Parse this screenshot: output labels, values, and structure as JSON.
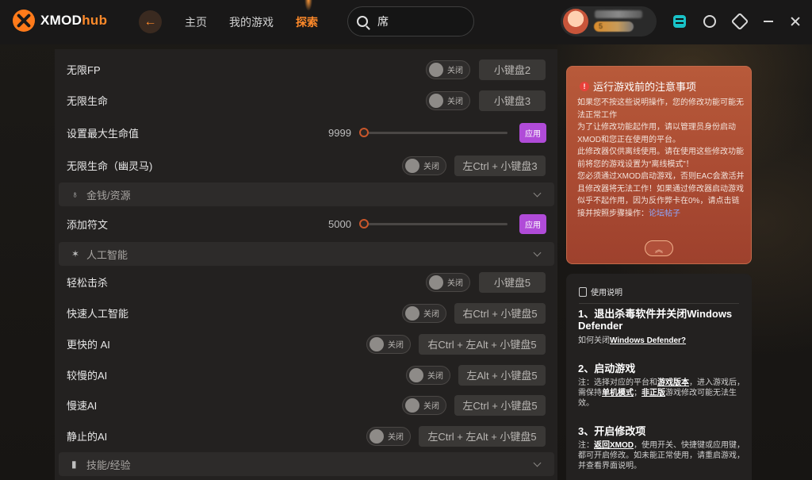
{
  "app": {
    "logo_main": "XMOD",
    "logo_accent": "hub"
  },
  "nav": {
    "back": "←",
    "home": "主页",
    "my_games": "我的游戏",
    "explore": "探索"
  },
  "search": {
    "value": "席"
  },
  "user": {
    "badge": "5"
  },
  "rows": {
    "inf_fp": {
      "label": "无限FP",
      "toggle": "关闭",
      "hotkey": "小键盘2"
    },
    "inf_hp": {
      "label": "无限生命",
      "toggle": "关闭",
      "hotkey": "小键盘3"
    },
    "max_hp": {
      "label": "设置最大生命值",
      "value": "9999",
      "apply": "应用"
    },
    "inf_hp_ghost": {
      "label": "无限生命（幽灵马)",
      "toggle": "关闭",
      "hotkey": "左Ctrl + 小键盘3"
    },
    "runes": {
      "label": "添加符文",
      "value": "5000",
      "apply": "应用"
    },
    "easy_kill": {
      "label": "轻松击杀",
      "toggle": "关闭",
      "hotkey": "小键盘5"
    },
    "fast_ai": {
      "label": "快速人工智能",
      "toggle": "关闭",
      "hotkey": "右Ctrl + 小键盘5"
    },
    "faster_ai": {
      "label": "更快的 AI",
      "toggle": "关闭",
      "hotkey": "右Ctrl + 左Alt + 小键盘5"
    },
    "slower_ai": {
      "label": "较慢的AI",
      "toggle": "关闭",
      "hotkey": "左Alt + 小键盘5"
    },
    "slow_ai": {
      "label": "慢速AI",
      "toggle": "关闭",
      "hotkey": "左Ctrl + 小键盘5"
    },
    "still_ai": {
      "label": "静止的AI",
      "toggle": "关闭",
      "hotkey": "左Ctrl + 左Alt + 小键盘5"
    }
  },
  "sections": {
    "money": {
      "title": "金钱/资源"
    },
    "ai": {
      "title": "人工智能"
    },
    "skills": {
      "title": "技能/经验"
    }
  },
  "warning": {
    "title": "运行游戏前的注意事项",
    "p1": "如果您不按这些说明操作，您的修改功能可能无法正常工作",
    "p2": "为了让修改功能起作用，请以管理员身份启动XMOD和您正在使用的平台。",
    "p3": "此修改器仅供离线使用。请在使用这些修改功能前将您的游戏设置为“离线模式”！",
    "p4": "您必须通过XMOD启动游戏，否则EAC会激活并且修改器将无法工作！如果通过修改器启动游戏似乎不起作用，因为反作弊卡在0%，请点击链接并按照步骤操作：",
    "link": "论坛帖子"
  },
  "guide": {
    "title": "使用说明",
    "s1_title": "1、退出杀毒软件并关闭Windows Defender",
    "s1_prefix": "如何关闭",
    "s1_link": "Windows Defender?",
    "s2_title": "2、启动游戏",
    "s2_a": "注：选择对应的平台和",
    "s2_link1": "游戏版本",
    "s2_b": "，进入游戏后，需保持",
    "s2_link2": "单机模式",
    "s2_c": "；",
    "s2_link3": "非正版",
    "s2_d": "游戏修改可能无法生效。",
    "s3_title": "3、开启修改项",
    "s3_a": "注：",
    "s3_link": "返回XMOD",
    "s3_b": "，使用开关、快捷键或应用键，都可开启修改。如未能正常使用，请重启游戏，并查看界面说明。"
  }
}
